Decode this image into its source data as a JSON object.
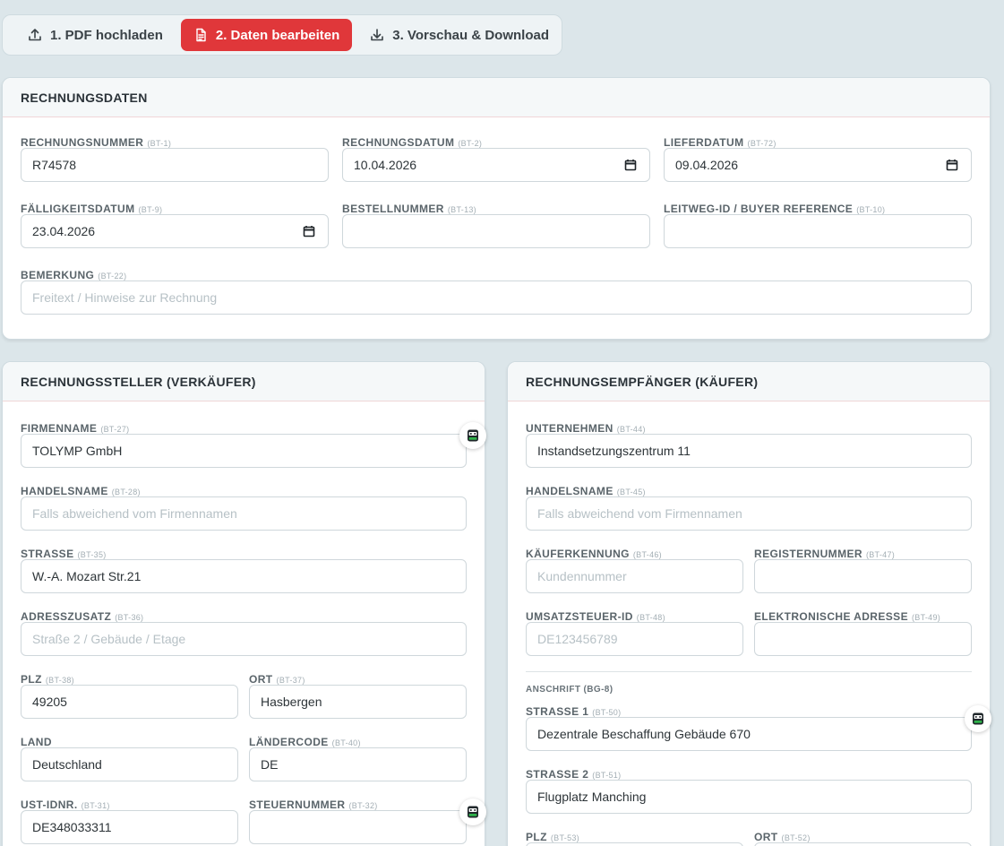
{
  "steps": [
    {
      "label": "1. PDF hochladen",
      "icon": "upload-icon",
      "active": false
    },
    {
      "label": "2. Daten bearbeiten",
      "icon": "document-icon",
      "active": true
    },
    {
      "label": "3. Vorschau & Download",
      "icon": "download-icon",
      "active": false
    }
  ],
  "colors": {
    "accent": "#e0373a",
    "background": "#dce6ea",
    "bot_green": "#2fb24a"
  },
  "invoice": {
    "title": "RECHNUNGSDATEN",
    "number": {
      "label": "RECHNUNGSNUMMER",
      "code": "(BT-1)",
      "value": "R74578"
    },
    "date": {
      "label": "RECHNUNGSDATUM",
      "code": "(BT-2)",
      "value": "10.04.2026"
    },
    "delivery": {
      "label": "LIEFERDATUM",
      "code": "(BT-72)",
      "value": "09.04.2026"
    },
    "due": {
      "label": "FÄLLIGKEITSDATUM",
      "code": "(BT-9)",
      "value": "23.04.2026"
    },
    "order": {
      "label": "BESTELLNUMMER",
      "code": "(BT-13)",
      "value": ""
    },
    "leitweg": {
      "label": "LEITWEG-ID / BUYER REFERENCE",
      "code": "(BT-10)",
      "value": ""
    },
    "note": {
      "label": "BEMERKUNG",
      "code": "(BT-22)",
      "placeholder": "Freitext / Hinweise zur Rechnung"
    }
  },
  "seller": {
    "title": "RECHNUNGSSTELLER (VERKÄUFER)",
    "company": {
      "label": "FIRMENNAME",
      "code": "(BT-27)",
      "value": "TOLYMP GmbH"
    },
    "trade": {
      "label": "HANDELSNAME",
      "code": "(BT-28)",
      "placeholder": "Falls abweichend vom Firmennamen"
    },
    "street": {
      "label": "STRASSE",
      "code": "(BT-35)",
      "value": "W.-A. Mozart Str.21"
    },
    "extra": {
      "label": "ADRESSZUSATZ",
      "code": "(BT-36)",
      "placeholder": "Straße 2 / Gebäude / Etage"
    },
    "zip": {
      "label": "PLZ",
      "code": "(BT-38)",
      "value": "49205"
    },
    "city": {
      "label": "ORT",
      "code": "(BT-37)",
      "value": "Hasbergen"
    },
    "country": {
      "label": "LAND",
      "code": "",
      "value": "Deutschland"
    },
    "country_code": {
      "label": "LÄNDERCODE",
      "code": "(BT-40)",
      "value": "DE"
    },
    "vat": {
      "label": "UST-IDNR.",
      "code": "(BT-31)",
      "value": "DE348033311"
    },
    "tax": {
      "label": "STEUERNUMMER",
      "code": "(BT-32)",
      "value": ""
    }
  },
  "buyer": {
    "title": "RECHNUNGSEMPFÄNGER (KÄUFER)",
    "company": {
      "label": "UNTERNEHMEN",
      "code": "(BT-44)",
      "value": "Instandsetzungszentrum 11"
    },
    "trade": {
      "label": "HANDELSNAME",
      "code": "(BT-45)",
      "placeholder": "Falls abweichend vom Firmennamen"
    },
    "buyer_id": {
      "label": "KÄUFERKENNUNG",
      "code": "(BT-46)",
      "placeholder": "Kundennummer"
    },
    "register": {
      "label": "REGISTERNUMMER",
      "code": "(BT-47)",
      "value": ""
    },
    "vat": {
      "label": "UMSATZSTEUER-ID",
      "code": "(BT-48)",
      "placeholder": "DE123456789"
    },
    "eaddress": {
      "label": "ELEKTRONISCHE ADRESSE",
      "code": "(BT-49)",
      "value": ""
    },
    "address_heading": "ANSCHRIFT (BG-8)",
    "street1": {
      "label": "STRASSE 1",
      "code": "(BT-50)",
      "value": "Dezentrale Beschaffung Gebäude 670"
    },
    "street2": {
      "label": "STRASSE 2",
      "code": "(BT-51)",
      "value": "Flugplatz Manching"
    },
    "zip": {
      "label": "PLZ",
      "code": "(BT-53)",
      "value": ""
    },
    "city": {
      "label": "ORT",
      "code": "(BT-52)",
      "value": ""
    }
  }
}
